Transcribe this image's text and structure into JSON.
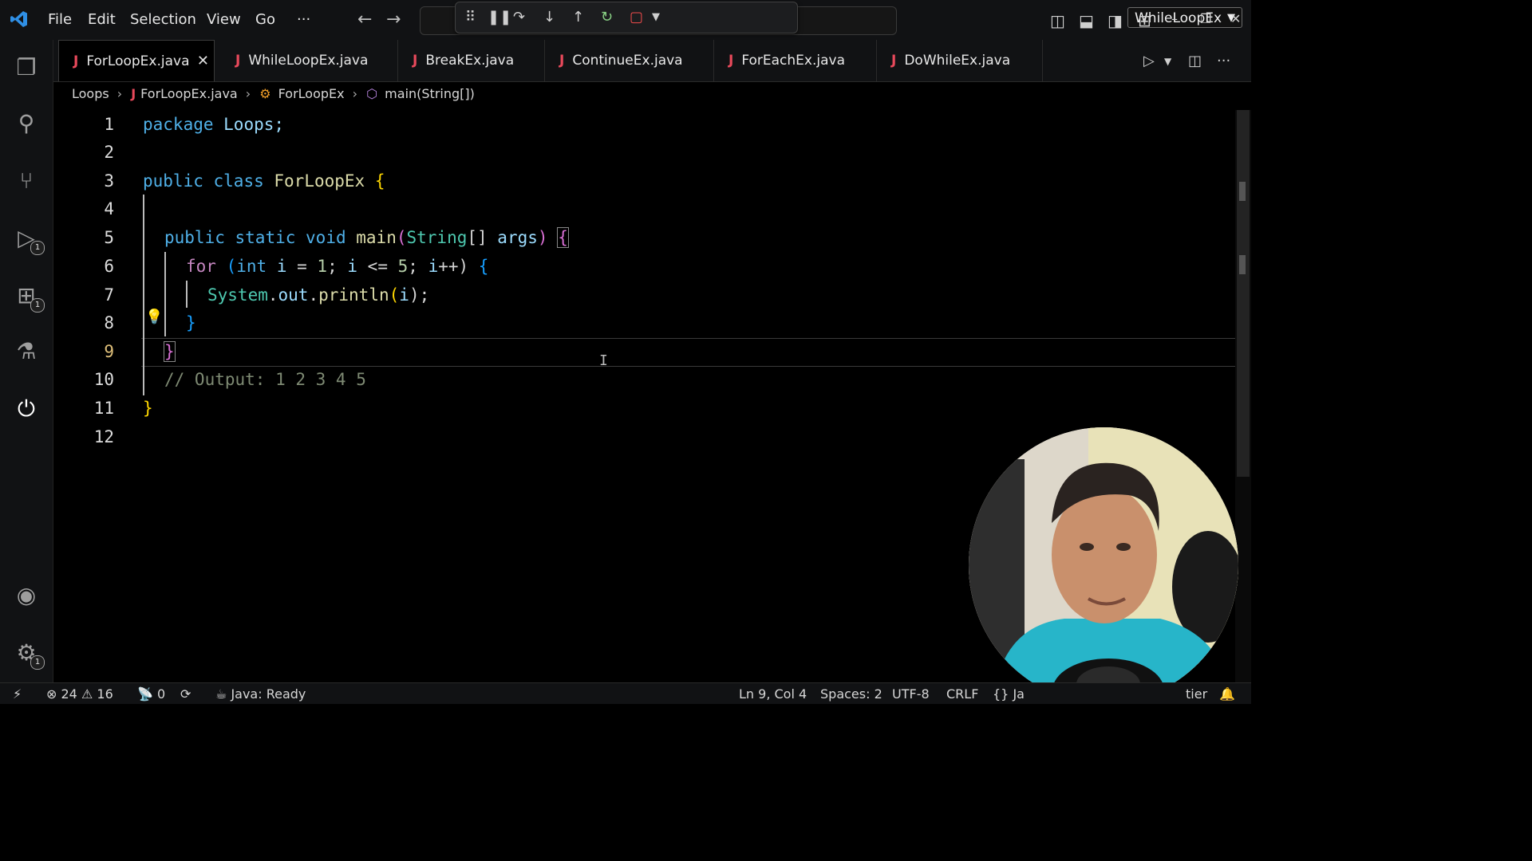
{
  "titlebar": {
    "menu": [
      "File",
      "Edit",
      "Selection",
      "View",
      "Go",
      "···"
    ],
    "launch_config": "WhileLoopEx"
  },
  "tabs": [
    {
      "label": "ForLoopEx.java",
      "active": true
    },
    {
      "label": "WhileLoopEx.java",
      "active": false
    },
    {
      "label": "BreakEx.java",
      "active": false
    },
    {
      "label": "ContinueEx.java",
      "active": false
    },
    {
      "label": "ForEachEx.java",
      "active": false
    },
    {
      "label": "DoWhileEx.java",
      "active": false
    }
  ],
  "breadcrumb": {
    "folder": "Loops",
    "file": "ForLoopEx.java",
    "class": "ForLoopEx",
    "method": "main(String[])"
  },
  "editor": {
    "line_numbers": [
      "1",
      "2",
      "3",
      "4",
      "5",
      "6",
      "7",
      "8",
      "9",
      "10",
      "11",
      "12"
    ],
    "current_line": "9",
    "code": {
      "l1_kw": "package",
      "l1_rest": " Loops;",
      "l3_kw1": "public",
      "l3_kw2": "class",
      "l3_cls": "ForLoopEx",
      "l3_br": "{",
      "l5_kw1": "public",
      "l5_kw2": "static",
      "l5_kw3": "void",
      "l5_fn": "main",
      "l5_p1": "(",
      "l5_typ": "String",
      "l5_arr": "[] ",
      "l5_var": "args",
      "l5_p2": ")",
      "l5_br": "{",
      "l6_kw": "for",
      "l6_a": " (",
      "l6_int": "int",
      "l6_b": " ",
      "l6_i1": "i",
      "l6_c": " = ",
      "l6_n1": "1",
      "l6_d": "; ",
      "l6_i2": "i",
      "l6_e": " <= ",
      "l6_n2": "5",
      "l6_f": "; ",
      "l6_i3": "i",
      "l6_g": "++) ",
      "l6_br": "{",
      "l7_cls": "System",
      "l7_a": ".",
      "l7_out": "out",
      "l7_b": ".",
      "l7_fn": "println",
      "l7_c": "(",
      "l7_var": "i",
      "l7_d": ");",
      "l8_br": "}",
      "l9_br": "}",
      "l10_cmt": "// Output: 1 2 3 4 5",
      "l11_br": "}"
    }
  },
  "statusbar": {
    "errors": "24",
    "warnings": "16",
    "ports": "0",
    "java_status": "Java: Ready",
    "position": "Ln 9, Col 4",
    "spaces": "Spaces: 2",
    "encoding": "UTF-8",
    "eol": "CRLF",
    "lang": "Ja",
    "right_partial": "tier"
  },
  "activity_badges": {
    "debug": "1",
    "extensions": "1",
    "settings": "1"
  },
  "colors": {
    "accent": "#2f8fe5",
    "java_icon": "#e8495b",
    "bulb": "#f5c518"
  }
}
